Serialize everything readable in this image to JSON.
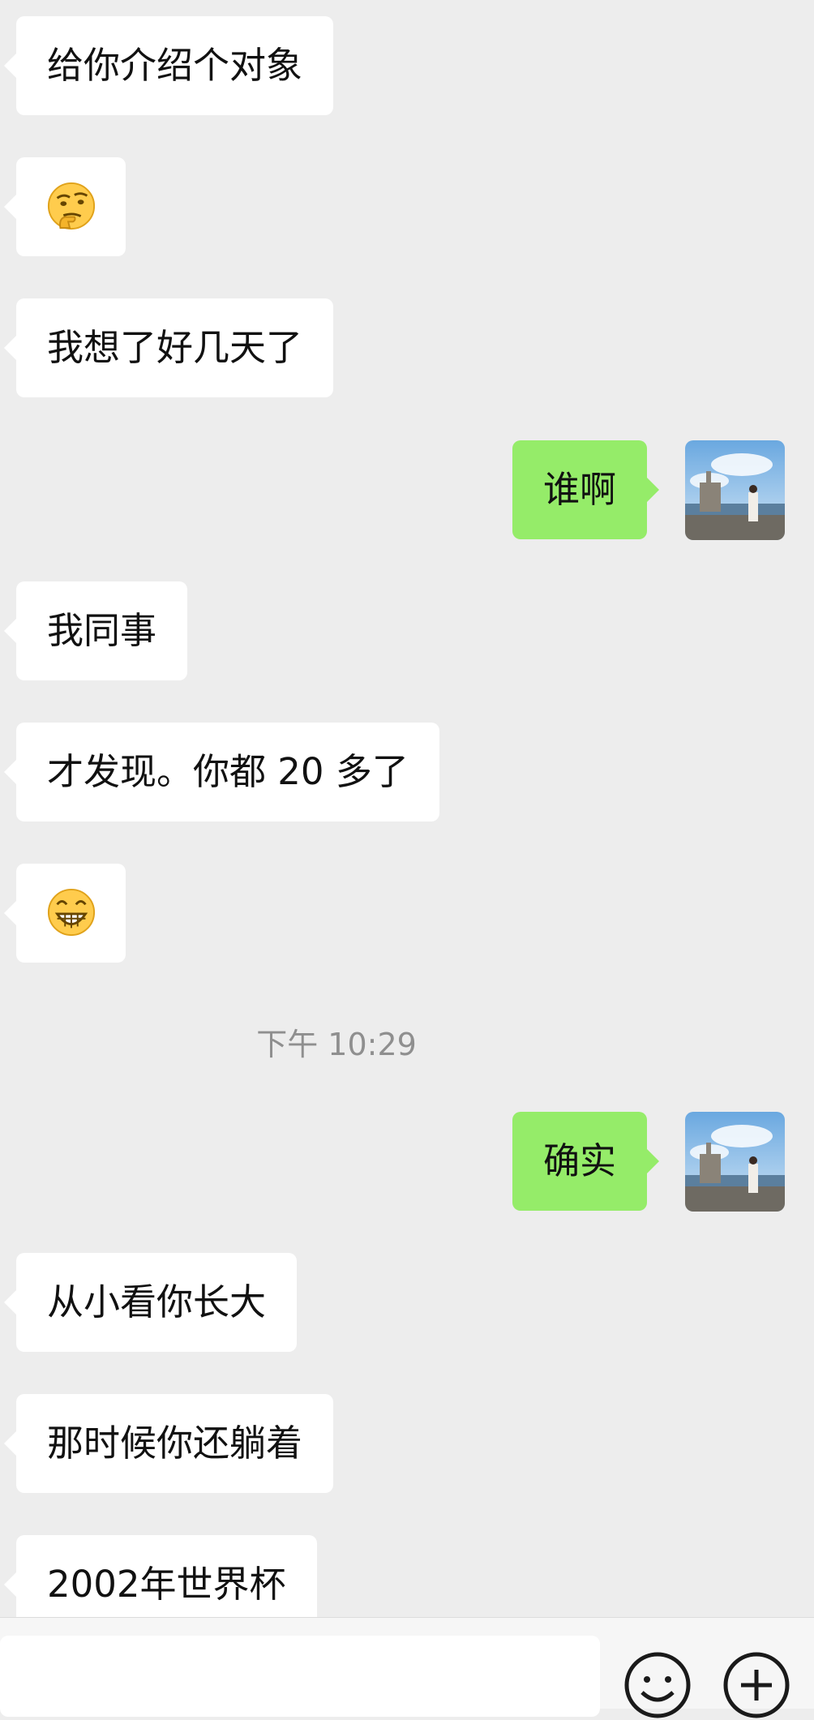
{
  "messages": [
    {
      "side": "left",
      "type": "text",
      "text": "给你介绍个对象"
    },
    {
      "side": "left",
      "type": "emoji",
      "emoji": "thinking-face"
    },
    {
      "side": "left",
      "type": "text",
      "text": "我想了好几天了"
    },
    {
      "side": "right",
      "type": "text",
      "text": "谁啊"
    },
    {
      "side": "left",
      "type": "text",
      "text": "我同事"
    },
    {
      "side": "left",
      "type": "text",
      "text": "才发现。你都 20 多了"
    },
    {
      "side": "left",
      "type": "emoji",
      "emoji": "grinning-face"
    },
    {
      "side": "right",
      "type": "text",
      "text": "确实"
    },
    {
      "side": "left",
      "type": "text",
      "text": "从小看你长大"
    },
    {
      "side": "left",
      "type": "text",
      "text": "那时候你还躺着"
    },
    {
      "side": "left",
      "type": "text",
      "text": "2002年世界杯"
    }
  ],
  "timestamp": "下午 10:29",
  "input_bar": {
    "icons": [
      "emoji-icon",
      "more-icon"
    ]
  },
  "colors": {
    "background": "#ededed",
    "left_bubble": "#ffffff",
    "right_bubble": "#95ec69",
    "timestamp_text": "#8f8f8f"
  }
}
